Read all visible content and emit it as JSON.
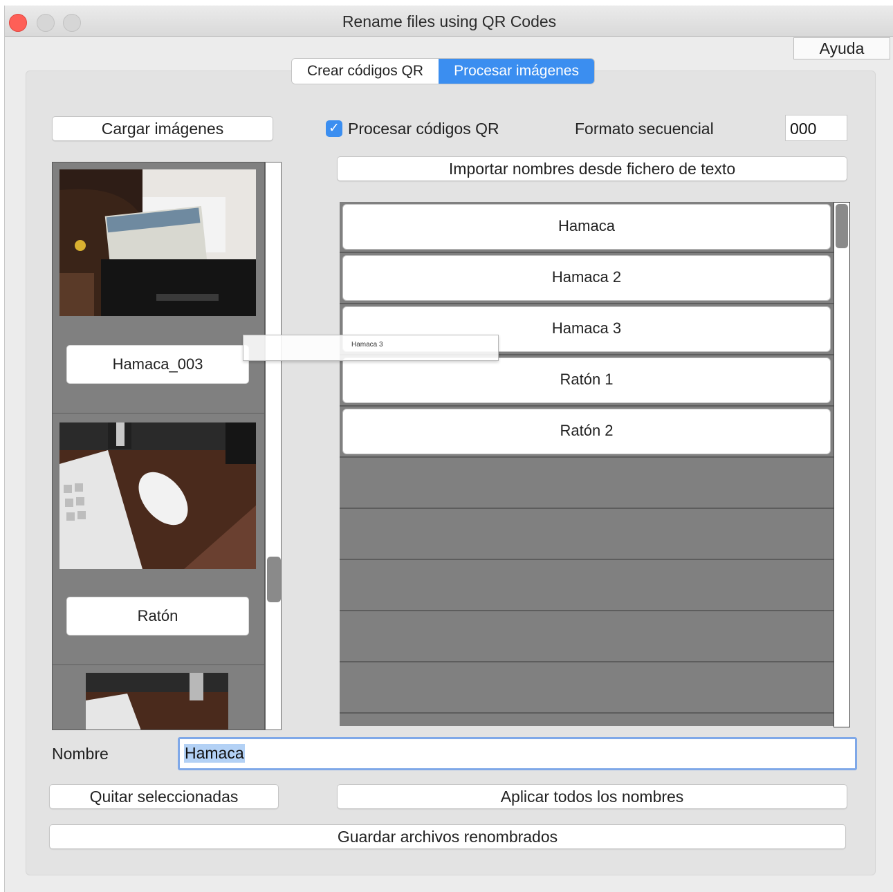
{
  "window": {
    "title": "Rename files using QR Codes"
  },
  "help_button": "Ayuda",
  "tabs": [
    {
      "label": "Crear códigos QR",
      "active": false
    },
    {
      "label": "Procesar imágenes",
      "active": true
    }
  ],
  "load_button": "Cargar imágenes",
  "process_qr": {
    "label": "Procesar códigos QR",
    "checked": true
  },
  "sequential_format": {
    "label": "Formato secuencial",
    "value": "000"
  },
  "import_button": "Importar nombres desde fichero de texto",
  "thumbnails": [
    {
      "name": "Hamaca_003"
    },
    {
      "name": "Ratón"
    }
  ],
  "names_list": [
    "Hamaca",
    "Hamaca 2",
    "Hamaca 3",
    "Ratón 1",
    "Ratón 2"
  ],
  "drag_preview": "Hamaca 3",
  "name_field": {
    "label": "Nombre",
    "value": "Hamaca"
  },
  "remove_button": "Quitar seleccionadas",
  "apply_button": "Aplicar todos los nombres",
  "save_button": "Guardar archivos renombrados",
  "colors": {
    "accent": "#3b8ef0",
    "list_bg": "#808080",
    "close": "#fe5f57"
  }
}
